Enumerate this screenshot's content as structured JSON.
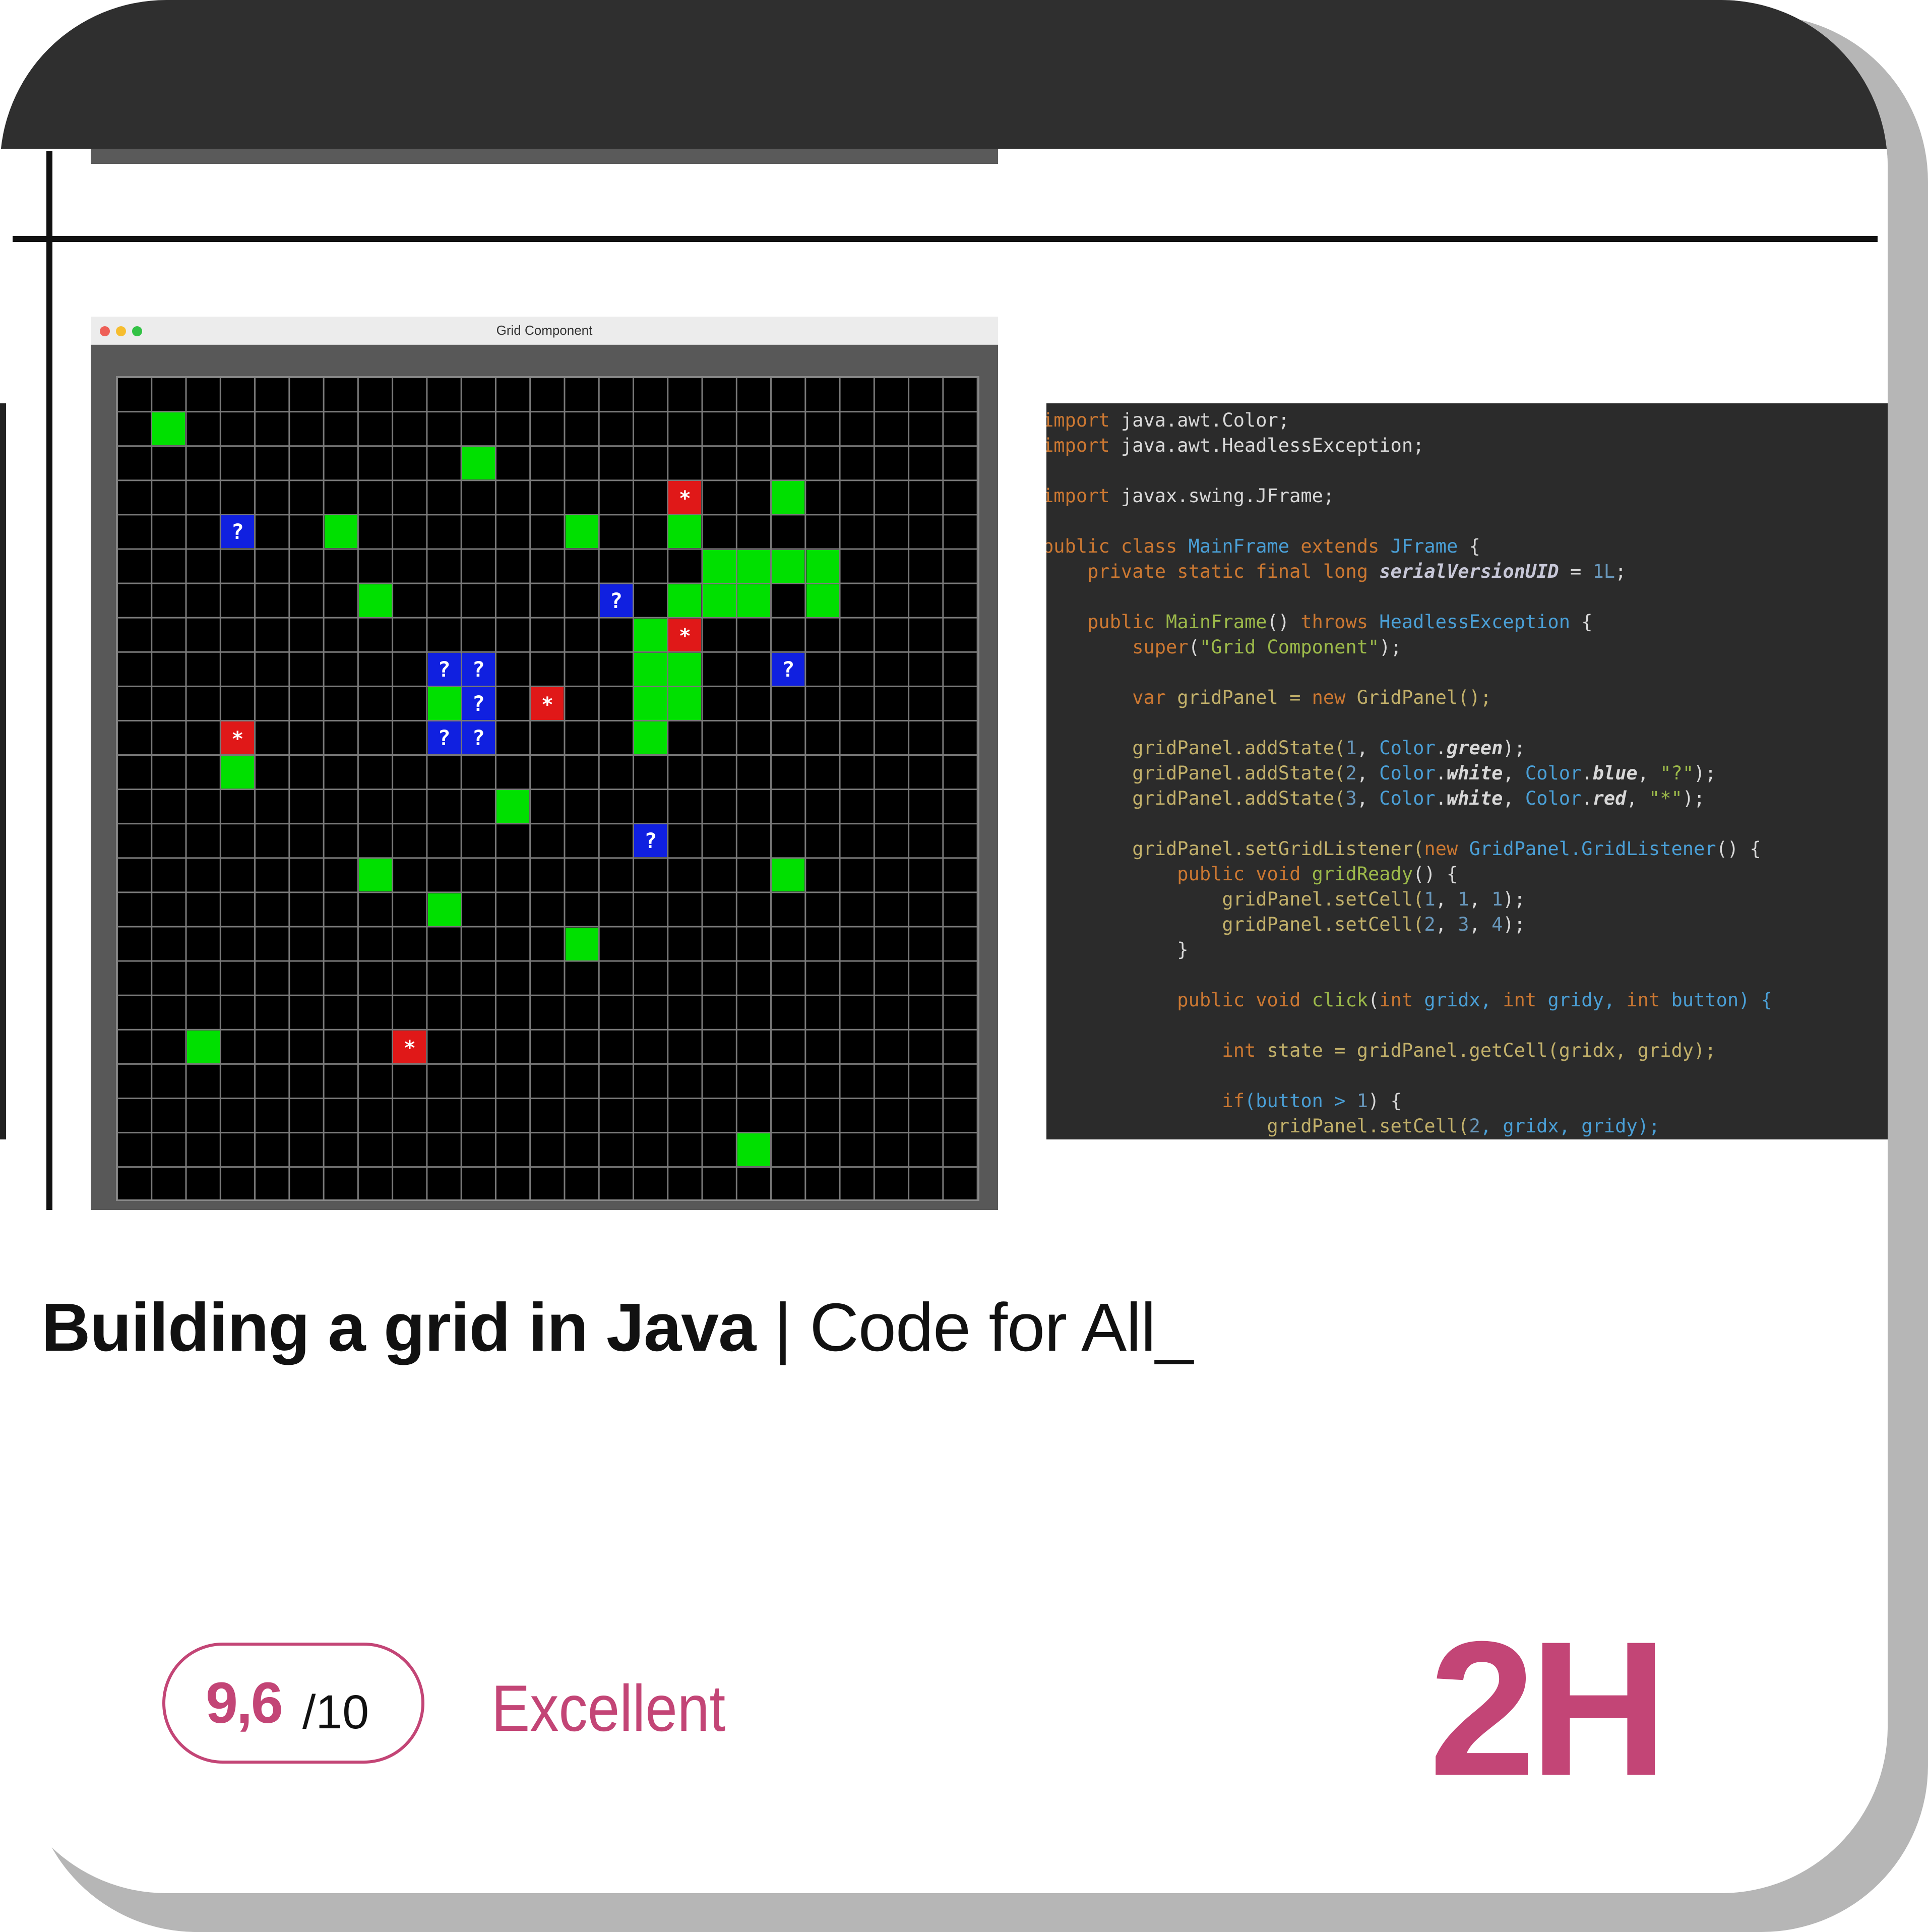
{
  "window": {
    "title": "Grid Component"
  },
  "grid": {
    "cols": 25,
    "rows": 24,
    "green_cells": [
      [
        1,
        1
      ],
      [
        10,
        2
      ],
      [
        19,
        3
      ],
      [
        6,
        4
      ],
      [
        13,
        4
      ],
      [
        16,
        4
      ],
      [
        17,
        5
      ],
      [
        18,
        5
      ],
      [
        19,
        5
      ],
      [
        20,
        5
      ],
      [
        7,
        6
      ],
      [
        16,
        6
      ],
      [
        17,
        6
      ],
      [
        18,
        6
      ],
      [
        20,
        6
      ],
      [
        15,
        7
      ],
      [
        15,
        8
      ],
      [
        16,
        8
      ],
      [
        15,
        9
      ],
      [
        16,
        9
      ],
      [
        9,
        9
      ],
      [
        15,
        10
      ],
      [
        3,
        11
      ],
      [
        11,
        12
      ],
      [
        7,
        14
      ],
      [
        19,
        14
      ],
      [
        9,
        15
      ],
      [
        13,
        16
      ],
      [
        2,
        19
      ],
      [
        18,
        22
      ]
    ],
    "blue_cells": [
      [
        3,
        4
      ],
      [
        14,
        6
      ],
      [
        9,
        8
      ],
      [
        10,
        8
      ],
      [
        19,
        8
      ],
      [
        10,
        9
      ],
      [
        9,
        10
      ],
      [
        10,
        10
      ],
      [
        15,
        13
      ]
    ],
    "red_cells": [
      [
        16,
        3
      ],
      [
        16,
        7
      ],
      [
        12,
        9
      ],
      [
        3,
        10
      ],
      [
        8,
        19
      ]
    ],
    "blue_symbol": "?",
    "red_symbol": "*"
  },
  "code": {
    "l1a": "import",
    "l1b": " java.awt.Color;",
    "l2a": "import",
    "l2b": " java.awt.HeadlessException;",
    "l3a": "import",
    "l3b": " javax.swing.JFrame;",
    "l4a": "public class ",
    "l4b": "MainFrame",
    "l4c": " extends ",
    "l4d": "JFrame",
    "l4e": " {",
    "l5a": "    private static final long ",
    "l5b": "serialVersionUID",
    "l5c": " = ",
    "l5d": "1L",
    "l5e": ";",
    "l6a": "    public ",
    "l6b": "MainFrame",
    "l6c": "() ",
    "l6d": "throws ",
    "l6e": "HeadlessException",
    "l6f": " {",
    "l7a": "        super",
    "l7b": "(",
    "l7c": "\"Grid Component\"",
    "l7d": ");",
    "l8a": "        var ",
    "l8b": "gridPanel = ",
    "l8c": "new ",
    "l8d": "GridPanel();",
    "l9a": "        gridPanel.addState(",
    "l9b": "1",
    "l9c": ", ",
    "l9d": "Color",
    "l9e": ".",
    "l9f": "green",
    "l9g": ");",
    "l10a": "        gridPanel.addState(",
    "l10b": "2",
    "l10c": ", ",
    "l10d": "Color",
    "l10e": ".",
    "l10f": "white",
    "l10g": ", ",
    "l10h": "Color",
    "l10i": ".",
    "l10j": "blue",
    "l10k": ", ",
    "l10l": "\"?\"",
    "l10m": ");",
    "l11a": "        gridPanel.addState(",
    "l11b": "3",
    "l11c": ", ",
    "l11d": "Color",
    "l11e": ".",
    "l11f": "white",
    "l11g": ", ",
    "l11h": "Color",
    "l11i": ".",
    "l11j": "red",
    "l11k": ", ",
    "l11l": "\"*\"",
    "l11m": ");",
    "l12a": "        gridPanel.setGridListener(",
    "l12b": "new ",
    "l12c": "GridPanel.GridListener",
    "l12d": "() {",
    "l13a": "            public void ",
    "l13b": "gridReady",
    "l13c": "() {",
    "l14a": "                gridPanel.setCell(",
    "l14b": "1",
    "l14c": ", ",
    "l14d": "1",
    "l14e": ", ",
    "l14f": "1",
    "l14g": ");",
    "l15a": "                gridPanel.setCell(",
    "l15b": "2",
    "l15c": ", ",
    "l15d": "3",
    "l15e": ", ",
    "l15f": "4",
    "l15g": ");",
    "l16": "            }",
    "l17a": "            public void ",
    "l17b": "click",
    "l17c": "(",
    "l17d": "int ",
    "l17e": "gridx, ",
    "l17f": "int ",
    "l17g": "gridy, ",
    "l17h": "int ",
    "l17i": "button) {",
    "l18a": "                int ",
    "l18b": "state = gridPanel.getCell(gridx, gridy);",
    "l19a": "                if",
    "l19b": "(button > ",
    "l19c": "1",
    "l19d": ") {",
    "l20a": "                    gridPanel.setCell(",
    "l20b": "2",
    "l20c": ", gridx, gridy);"
  },
  "course": {
    "title_bold": "Building a grid in Java",
    "title_rest": " | Code for All_"
  },
  "rating": {
    "score": "9,6",
    "max": "/10",
    "label": "Excellent"
  },
  "duration": "2H",
  "colors": {
    "accent": "#c34576",
    "green": "#00e000",
    "blue": "#1020e0",
    "red": "#e01818",
    "code_bg": "#2b2b2b"
  }
}
